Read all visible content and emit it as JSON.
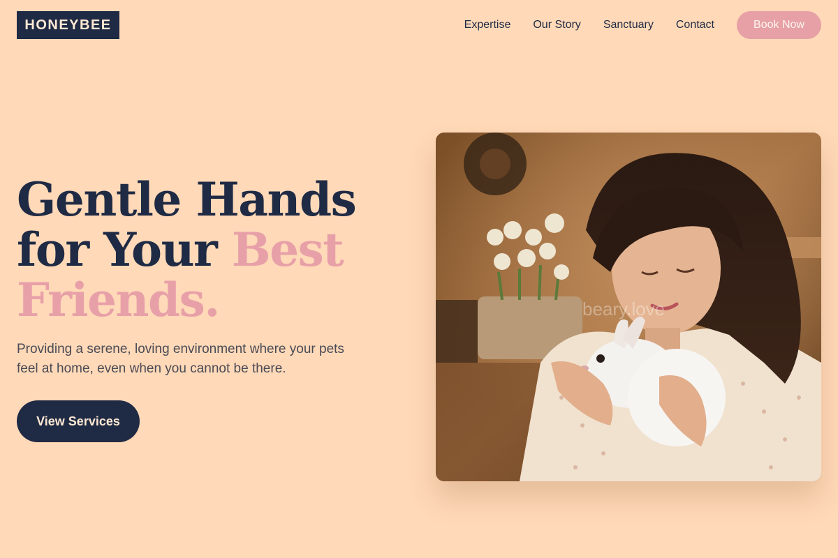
{
  "header": {
    "logo": "HONEYBEE",
    "nav": [
      {
        "label": "Expertise"
      },
      {
        "label": "Our Story"
      },
      {
        "label": "Sanctuary"
      },
      {
        "label": "Contact"
      }
    ],
    "cta_label": "Book Now"
  },
  "hero": {
    "title_line1": "Gentle Hands",
    "title_line2_prefix": "for Your ",
    "title_line2_accent": "Best",
    "title_line3_accent": "Friends.",
    "subtitle": "Providing a serene, loving environment where your pets feel at home, even when you cannot be there.",
    "cta_label": "View Services",
    "image_watermark": "beary.love"
  },
  "colors": {
    "background": "#FFD9B8",
    "navy": "#1F2A44",
    "pink_accent": "#E8A0A8"
  }
}
